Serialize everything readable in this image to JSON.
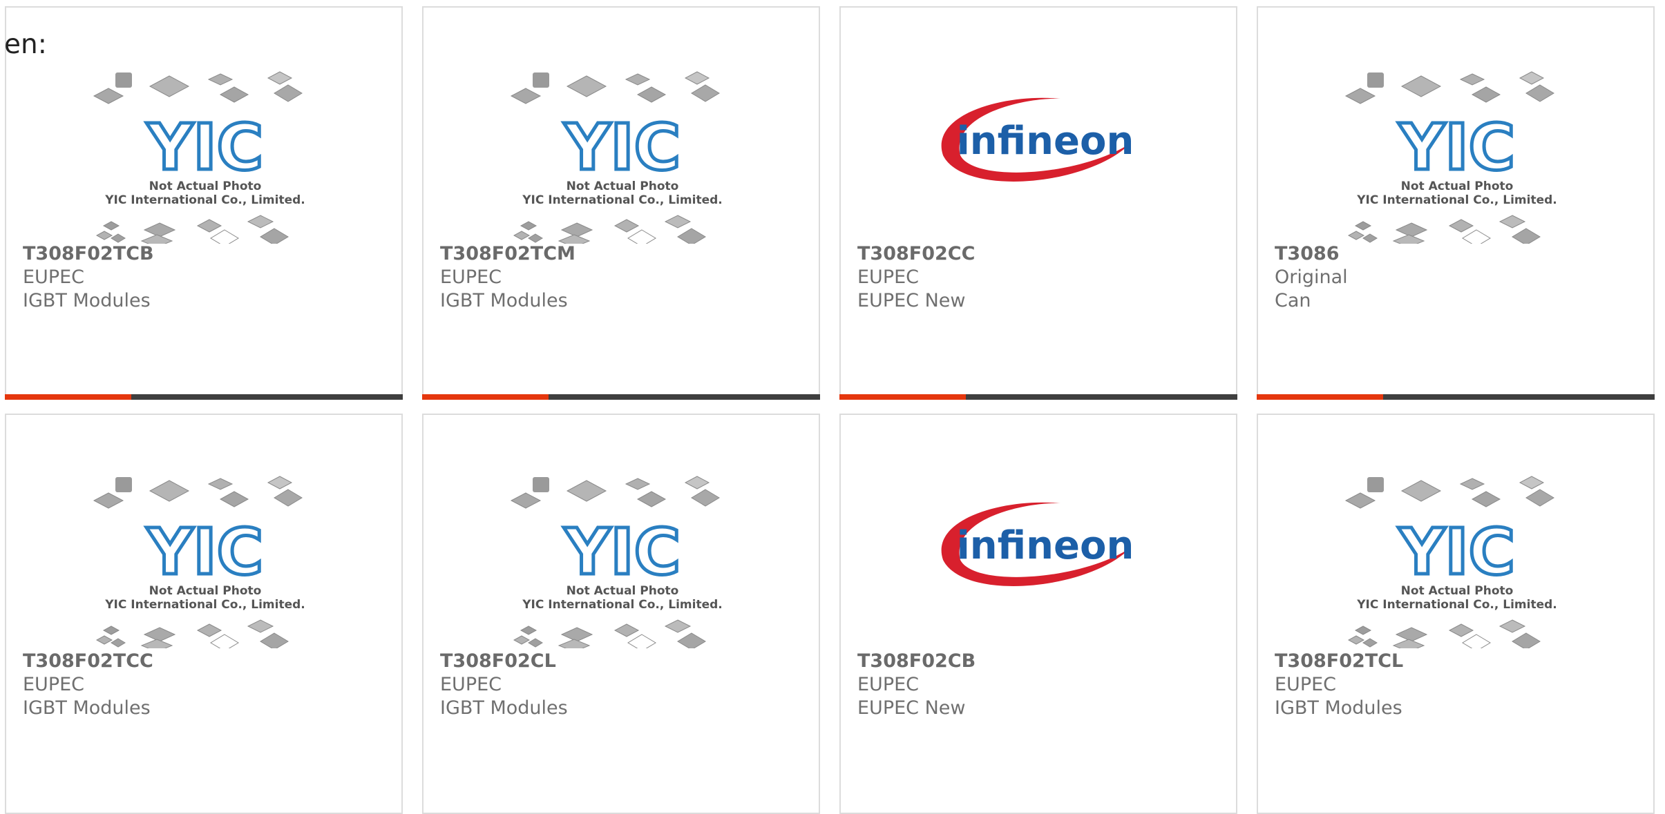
{
  "language_label": "en:",
  "placeholder_text": {
    "line1": "Not Actual Photo",
    "line2": "YIC International Co., Limited."
  },
  "logo_text": {
    "yic": "YIC",
    "infineon": "infineon"
  },
  "colors": {
    "accent": "#e5370e",
    "bar": "#3f3f3f",
    "yic_blue": "#2a7fc1",
    "infineon_blue": "#1c5fa8",
    "infineon_red": "#d8202d"
  },
  "products": [
    {
      "part": "T308F02TCB",
      "brand": "EUPEC",
      "category": "IGBT Modules",
      "image": "yic-placeholder"
    },
    {
      "part": "T308F02TCM",
      "brand": "EUPEC",
      "category": "IGBT Modules",
      "image": "yic-placeholder"
    },
    {
      "part": "T308F02CC",
      "brand": "EUPEC",
      "category": "EUPEC New",
      "image": "infineon-logo"
    },
    {
      "part": "T3086",
      "brand": "Original",
      "category": "Can",
      "image": "yic-placeholder"
    },
    {
      "part": "T308F02TCC",
      "brand": "EUPEC",
      "category": "IGBT Modules",
      "image": "yic-placeholder"
    },
    {
      "part": "T308F02CL",
      "brand": "EUPEC",
      "category": "IGBT Modules",
      "image": "yic-placeholder"
    },
    {
      "part": "T308F02CB",
      "brand": "EUPEC",
      "category": "EUPEC New",
      "image": "infineon-logo"
    },
    {
      "part": "T308F02TCL",
      "brand": "EUPEC",
      "category": "IGBT Modules",
      "image": "yic-placeholder"
    }
  ]
}
